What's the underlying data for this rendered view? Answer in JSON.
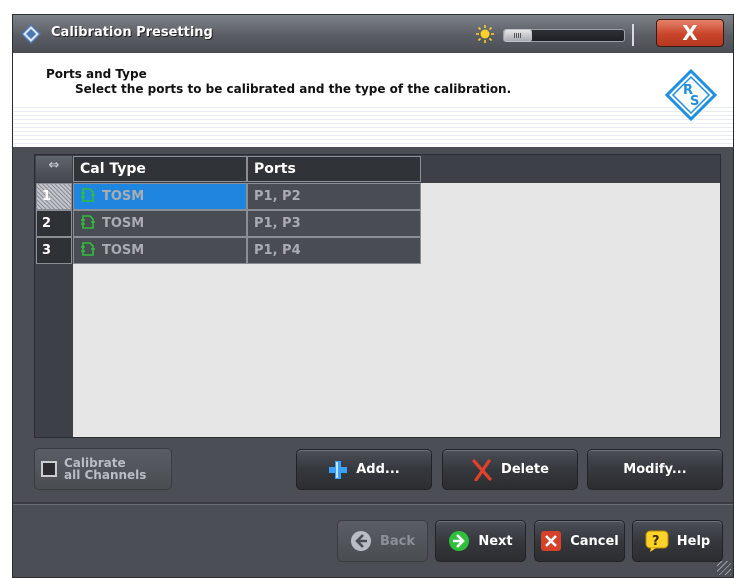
{
  "window": {
    "title": "Calibration Presetting",
    "close_label": "X"
  },
  "header": {
    "title": "Ports and Type",
    "subtitle": "Select the ports to be calibrated and the type of the calibration."
  },
  "table": {
    "columns": [
      "Cal Type",
      "Ports"
    ],
    "rows": [
      {
        "num": "1",
        "cal_type": "TOSM",
        "ports": "P1, P2",
        "selected": true
      },
      {
        "num": "2",
        "cal_type": "TOSM",
        "ports": "P1, P3",
        "selected": false
      },
      {
        "num": "3",
        "cal_type": "TOSM",
        "ports": "P1, P4",
        "selected": false
      }
    ]
  },
  "controls": {
    "calibrate_all_line1": "Calibrate",
    "calibrate_all_line2": "all Channels",
    "calibrate_all_checked": false,
    "add_label": "Add...",
    "delete_label": "Delete",
    "modify_label": "Modify..."
  },
  "footer": {
    "back_label": "Back",
    "next_label": "Next",
    "cancel_label": "Cancel",
    "help_label": "Help"
  },
  "colors": {
    "selection": "#1f86e0",
    "window_bg": "#4b4f55",
    "close_button": "#c9452a",
    "cal_icon": "#2fbf3a"
  },
  "icons": [
    "app-logo-icon",
    "brightness-icon",
    "close-icon",
    "rs-logo-icon",
    "expand-columns-icon",
    "cal-kit-icon",
    "plus-icon",
    "x-delete-icon",
    "arrow-left-icon",
    "arrow-right-icon",
    "cancel-icon",
    "help-icon"
  ]
}
